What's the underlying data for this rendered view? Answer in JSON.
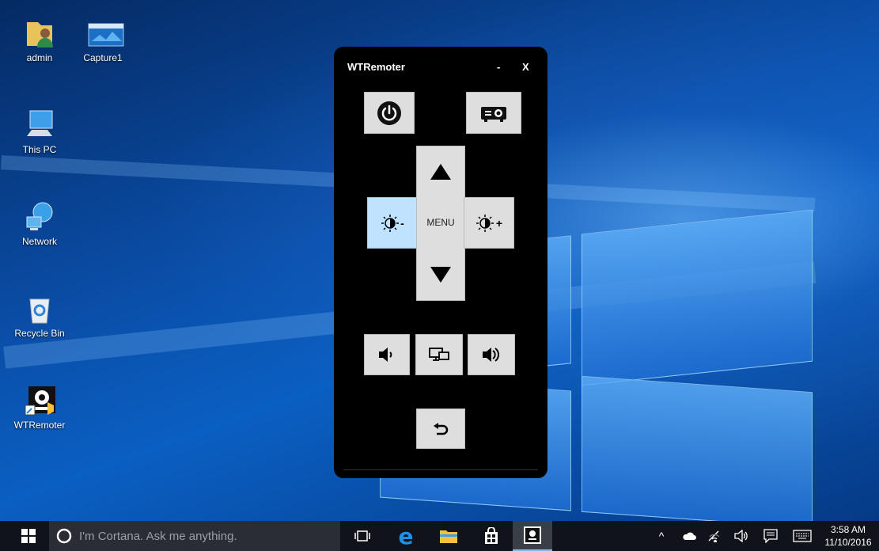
{
  "desktop": {
    "icons": [
      {
        "label": "admin",
        "icon": "user-folder-icon"
      },
      {
        "label": "Capture1",
        "icon": "image-file-icon"
      },
      {
        "label": "This PC",
        "icon": "computer-icon"
      },
      {
        "label": "Network",
        "icon": "network-icon"
      },
      {
        "label": "Recycle Bin",
        "icon": "recycle-bin-icon"
      },
      {
        "label": "WTRemoter",
        "icon": "wtremoter-shortcut-icon"
      }
    ]
  },
  "remote": {
    "title": "WTRemoter",
    "minimize_label": "-",
    "close_label": "X",
    "menu_label": "MENU",
    "brightness_down_suffix": "-",
    "brightness_up_suffix": "+",
    "active_button": "brightness-down"
  },
  "taskbar": {
    "search_placeholder": "I'm Cortana. Ask me anything.",
    "time": "3:58 AM",
    "date": "11/10/2016",
    "background": "#10131a"
  },
  "colors": {
    "button_bg": "#dedede",
    "button_active_bg": "#bfe2ff",
    "window_bg": "#000000"
  }
}
